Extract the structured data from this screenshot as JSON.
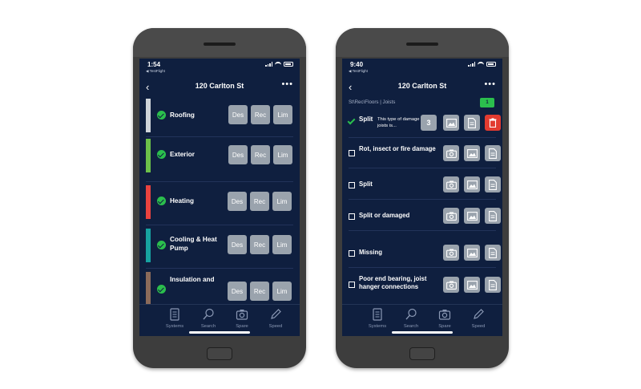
{
  "left_phone": {
    "status": {
      "time": "1:54",
      "sub": "◀ TestFlight"
    },
    "title": "120 Carlton St",
    "systems": [
      {
        "label": "Roofing",
        "color": "#cfd4da"
      },
      {
        "label": "Exterior",
        "color": "#6cc04a"
      },
      {
        "label": "Heating",
        "color": "#e8423f"
      },
      {
        "label": "Cooling & Heat Pump",
        "color": "#17a2a1"
      },
      {
        "label": "Insulation and",
        "color": "#8a6a5a"
      }
    ],
    "buttons": [
      "Des",
      "Rec",
      "Lim"
    ]
  },
  "right_phone": {
    "status": {
      "time": "9:40",
      "sub": "◀ TestFlight"
    },
    "title": "120 Carlton St",
    "breadcrumb": "St\\Rec\\Floors | Joists",
    "badge": "1",
    "selected": {
      "title": "Split",
      "desc": "This type of damage to joists is...",
      "count": "3"
    },
    "items": [
      {
        "label": "Rot, insect or fire damage"
      },
      {
        "label": "Split"
      },
      {
        "label": "Split or damaged"
      },
      {
        "label": "Missing"
      },
      {
        "label": "Poor end bearing, joist hanger connections"
      }
    ]
  },
  "tabbar": {
    "tabs": [
      "Systems",
      "Search",
      "Spare",
      "Speed"
    ]
  },
  "icons": {
    "nav": [
      "back-chevron-icon",
      "more-dots-icon"
    ],
    "tabs": [
      "checklist-icon",
      "search-icon",
      "camera-icon",
      "pencil-icon"
    ],
    "row_actions": [
      "camera-icon",
      "image-icon",
      "document-icon",
      "trash-icon"
    ]
  }
}
